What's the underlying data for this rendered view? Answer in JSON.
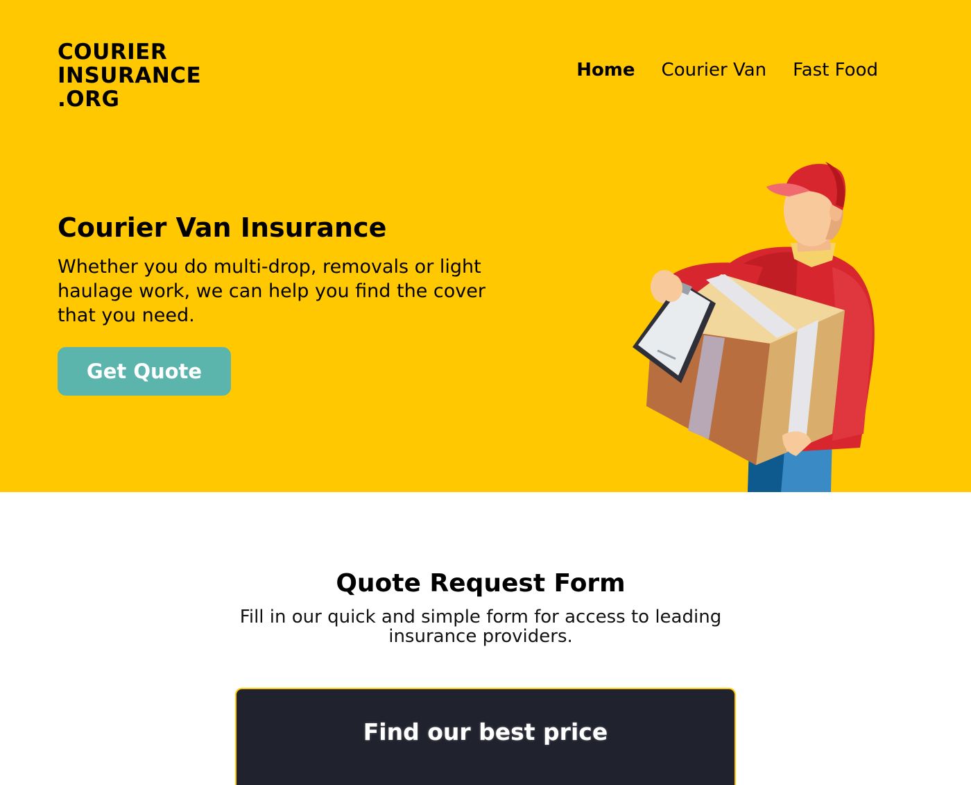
{
  "header": {
    "logo_lines": [
      "COURIER",
      "INSURANCE",
      ".ORG"
    ],
    "nav": [
      {
        "label": "Home",
        "active": true
      },
      {
        "label": "Courier Van",
        "active": false
      },
      {
        "label": "Fast Food",
        "active": false
      }
    ]
  },
  "hero": {
    "title": "Courier Van Insurance",
    "subtitle": "Whether you do multi-drop, removals or light haulage work, we can help you find the cover that you need.",
    "cta_label": "Get Quote",
    "illustration": "courier-holding-box-illustration"
  },
  "quote_form": {
    "title": "Quote Request Form",
    "subtitle": "Fill in our quick and simple form for access to leading insurance providers.",
    "card_title": "Find our best price"
  },
  "colors": {
    "hero_bg": "#ffc800",
    "button_bg": "#5bb5ad",
    "card_bg": "#20222d"
  }
}
